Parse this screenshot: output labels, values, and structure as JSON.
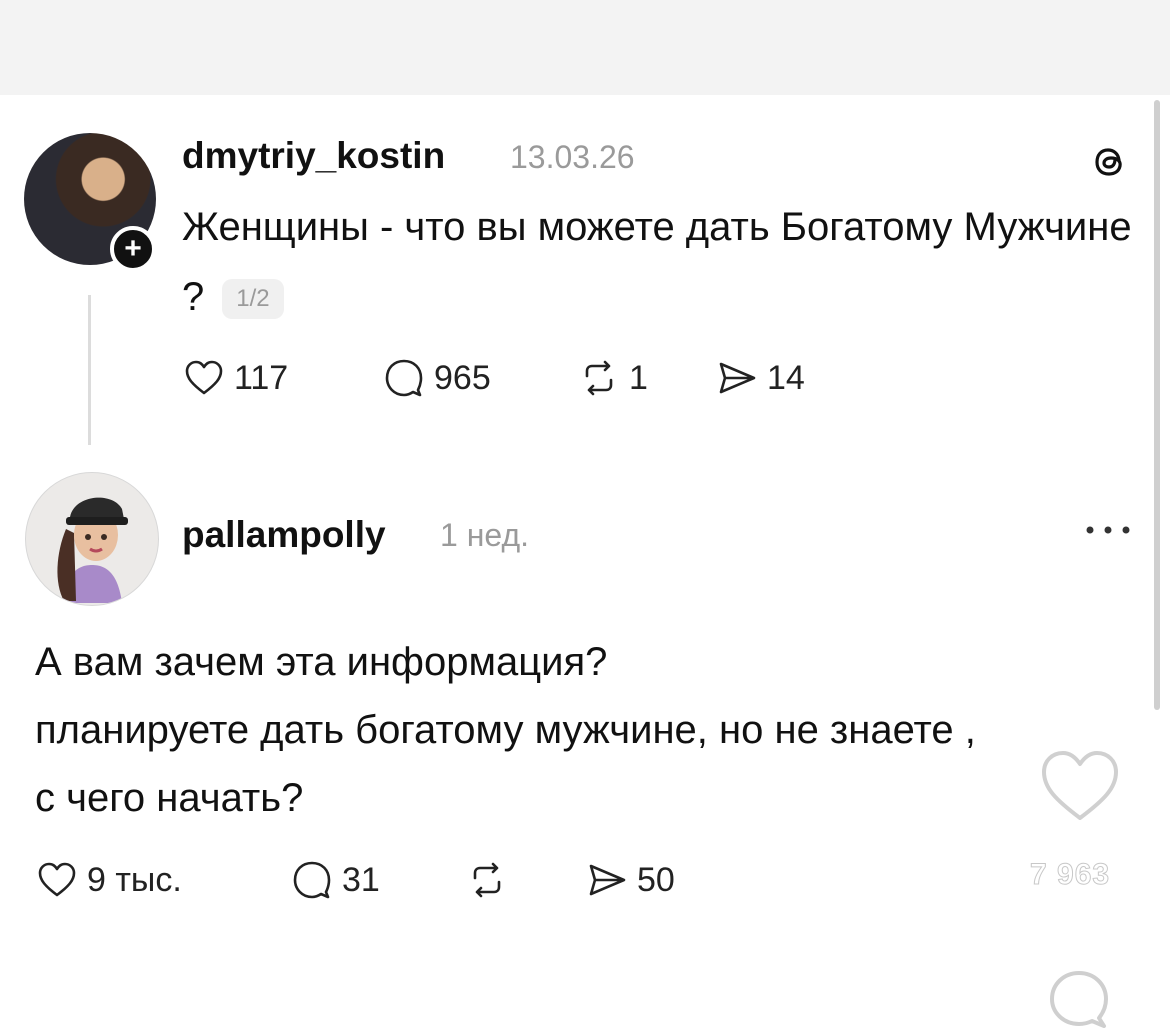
{
  "post": {
    "username": "dmytriy_kostin",
    "date": "13.03.26",
    "text": "Женщины - что вы можете дать Богатому Мужчине ?",
    "page_indicator": "1/2",
    "likes": "117",
    "comments": "965",
    "reposts": "1",
    "shares": "14"
  },
  "reply": {
    "username": "pallampolly",
    "time": "1 нед.",
    "lines": [
      "А вам зачем эта информация?",
      "планируете дать богатому мужчине, но не знаете ,",
      "с чего начать?"
    ],
    "likes": "9 тыс.",
    "comments": "31",
    "shares": "50"
  },
  "overlay": {
    "like_count": "7 963"
  },
  "icons": {
    "avatar_follow_badge": "+"
  }
}
